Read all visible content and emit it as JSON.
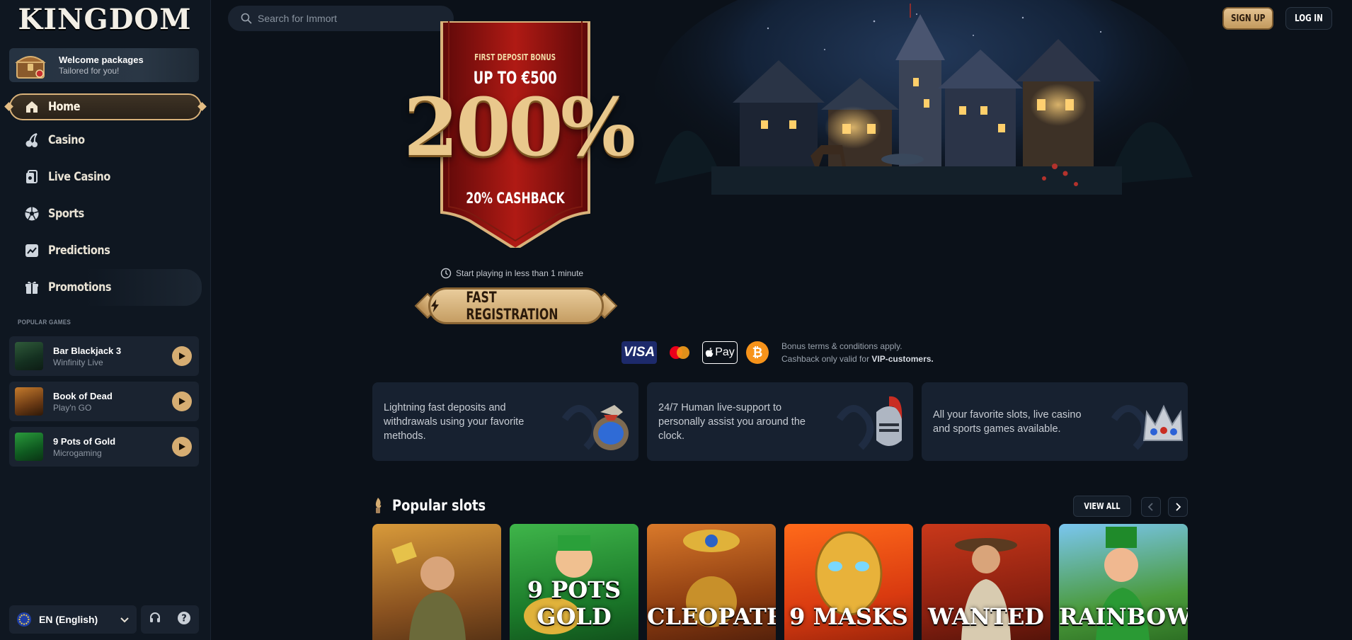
{
  "brand": {
    "logo_text": "KINGDOM"
  },
  "header": {
    "search_placeholder": "Search for Immort",
    "signup_label": "SIGN UP",
    "login_label": "LOG IN"
  },
  "sidebar": {
    "welcome": {
      "title": "Welcome packages",
      "subtitle": "Tailored for you!",
      "icon": "treasure-chest-icon"
    },
    "nav": [
      {
        "label": "Home",
        "icon": "home-icon",
        "active": true
      },
      {
        "label": "Casino",
        "icon": "cherries-icon"
      },
      {
        "label": "Live Casino",
        "icon": "live-cards-icon"
      },
      {
        "label": "Sports",
        "icon": "soccer-ball-icon"
      },
      {
        "label": "Predictions",
        "icon": "trend-chart-icon"
      },
      {
        "label": "Promotions",
        "icon": "gift-icon"
      }
    ],
    "popular_games_title": "POPULAR GAMES",
    "popular_games": [
      {
        "name": "Bar Blackjack 3",
        "provider": "Winfinity Live"
      },
      {
        "name": "Book of Dead",
        "provider": "Play'n GO"
      },
      {
        "name": "9 Pots of Gold",
        "provider": "Microgaming"
      }
    ],
    "language": "EN (English)"
  },
  "hero": {
    "bonus_small": "FIRST DEPOSIT BONUS",
    "bonus_amount": "UP TO €500",
    "bonus_percent": "200%",
    "cashback": "20% CASHBACK",
    "start_text": "Start playing in less than 1 minute",
    "register_label": "FAST REGISTRATION",
    "payments": {
      "visa": "VISA",
      "applepay": "Pay"
    },
    "terms_line1": "Bonus terms & conditions apply.",
    "terms_line2_prefix": "Cashback only valid for",
    "terms_line2_bold": "VIP-customers."
  },
  "features": [
    {
      "text": "Lightning fast deposits and withdrawals using your favorite methods.",
      "icon": "money-bag-icon"
    },
    {
      "text": "24/7 Human live-support to personally assist you around the clock.",
      "icon": "knight-helmet-icon"
    },
    {
      "text": "All your favorite slots, live casino and sports games available.",
      "icon": "crown-icon"
    }
  ],
  "popular_slots": {
    "title": "Popular slots",
    "view_all": "VIEW ALL",
    "games": [
      {
        "title": ""
      },
      {
        "title": "9 POTS GOLD"
      },
      {
        "title": "CLEOPATRA"
      },
      {
        "title": "9 MASKS"
      },
      {
        "title": "WANTED"
      },
      {
        "title": "RAINBOW"
      }
    ]
  },
  "colors": {
    "background": "#0b1119",
    "sidebar": "#0f1721",
    "accent_gold": "#d6ad72",
    "banner_red": "#8f1010",
    "card": "#172130"
  }
}
